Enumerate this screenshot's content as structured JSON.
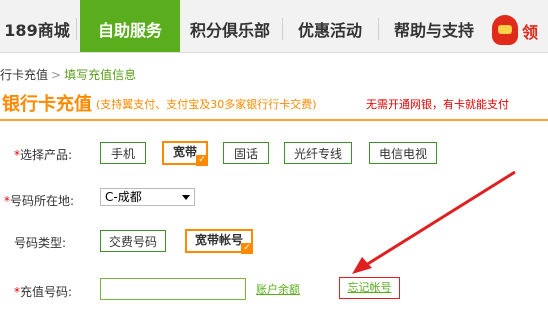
{
  "nav": {
    "items": [
      {
        "label": "189商城"
      },
      {
        "label": "自助服务"
      },
      {
        "label": "积分俱乐部"
      },
      {
        "label": "优惠活动"
      },
      {
        "label": "帮助与支持"
      }
    ],
    "logo_text": "领"
  },
  "breadcrumb": {
    "parent": "行卡充值",
    "separator": ">",
    "current": "填写充值信息"
  },
  "page": {
    "title": "银行卡充值",
    "subtitle": "(支持翼支付、支付宝及30多家银行行卡交费)",
    "note": "无需开通网银，有卡就能支付"
  },
  "form": {
    "product": {
      "label": "选择产品:",
      "options": [
        "手机",
        "宽带",
        "固话",
        "光纤专线",
        "电信电视"
      ],
      "selected": "宽带"
    },
    "location": {
      "label": "号码所在地:",
      "value": "C-成都"
    },
    "number_type": {
      "label": "号码类型:",
      "options": [
        "交费号码",
        "宽带帐号"
      ],
      "selected": "宽带帐号"
    },
    "recharge_number": {
      "label": "充值号码:",
      "value": "",
      "balance_link": "账户余额",
      "forgot_link": "忘记帐号"
    }
  },
  "annotation": {
    "arrow_color": "#e02020"
  }
}
